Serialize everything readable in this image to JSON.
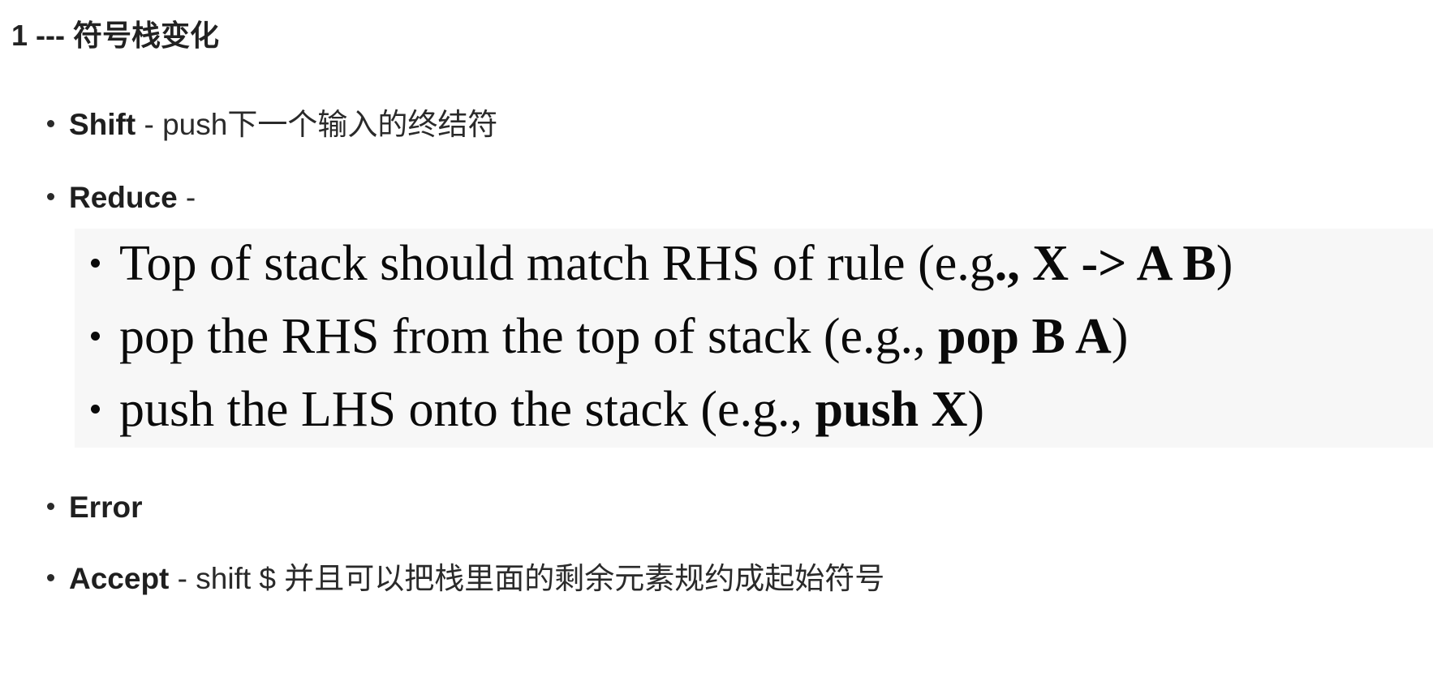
{
  "heading": "1 --- 符号栈变化",
  "items": [
    {
      "term": "Shift",
      "rest": " - push下一个输入的终结符"
    },
    {
      "term": "Reduce",
      "rest": " -"
    },
    {
      "term": "Error",
      "rest": ""
    },
    {
      "term": "Accept",
      "rest": " - shift $ 并且可以把栈里面的剩余元素规约成起始符号"
    }
  ],
  "reduce_image": {
    "lines": [
      {
        "text": "Top of stack should match RHS of rule (e.g",
        "bold": "., X -> A B",
        "close": ")"
      },
      {
        "text": "pop the RHS from the top of stack (e.g., ",
        "bold": "pop B A",
        "close": ")"
      },
      {
        "text": "push the LHS onto the stack (e.g., ",
        "bold": "push X",
        "close": ")"
      }
    ]
  }
}
